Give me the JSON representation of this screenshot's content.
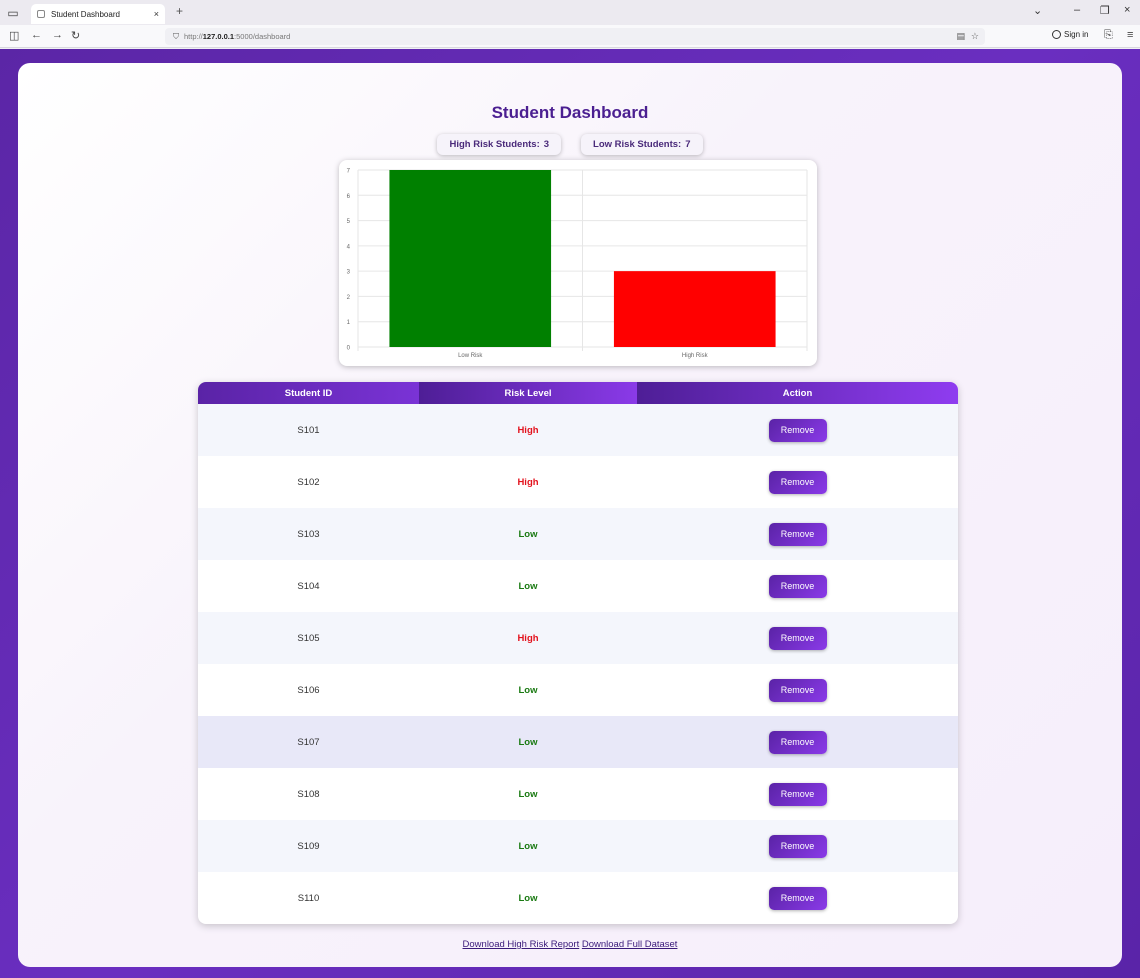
{
  "browser": {
    "tab_title": "Student Dashboard",
    "tab_close": "×",
    "new_tab": "+",
    "url_scheme": "http://",
    "url_host": "127.0.0.1",
    "url_path": ":5000/dashboard",
    "sign_in": "Sign in",
    "window_controls": {
      "minimize": "–",
      "restore": "❐",
      "close": "×"
    }
  },
  "page": {
    "title": "Student Dashboard",
    "stats": [
      {
        "label": "High Risk Students:",
        "value": "3"
      },
      {
        "label": "Low Risk Students:",
        "value": "7"
      }
    ]
  },
  "chart_data": {
    "type": "bar",
    "categories": [
      "Low Risk",
      "High Risk"
    ],
    "values": [
      7,
      3
    ],
    "colors": [
      "#008000",
      "#ff0000"
    ],
    "ylim": [
      0,
      7
    ],
    "yticks": [
      0,
      1,
      2,
      3,
      4,
      5,
      6,
      7
    ],
    "grid": true,
    "title": "",
    "xlabel": "",
    "ylabel": ""
  },
  "table": {
    "headers": [
      "Student ID",
      "Risk Level",
      "Action"
    ],
    "rows": [
      {
        "id": "S101",
        "risk": "High",
        "action": "Remove"
      },
      {
        "id": "S102",
        "risk": "High",
        "action": "Remove"
      },
      {
        "id": "S103",
        "risk": "Low",
        "action": "Remove"
      },
      {
        "id": "S104",
        "risk": "Low",
        "action": "Remove"
      },
      {
        "id": "S105",
        "risk": "High",
        "action": "Remove"
      },
      {
        "id": "S106",
        "risk": "Low",
        "action": "Remove"
      },
      {
        "id": "S107",
        "risk": "Low",
        "action": "Remove"
      },
      {
        "id": "S108",
        "risk": "Low",
        "action": "Remove"
      },
      {
        "id": "S109",
        "risk": "Low",
        "action": "Remove"
      },
      {
        "id": "S110",
        "risk": "Low",
        "action": "Remove"
      }
    ]
  },
  "downloads": {
    "high_risk": "Download High Risk Report",
    "full": "Download Full Dataset"
  },
  "colors": {
    "accent": "#5a23a6",
    "title": "#4b1f91",
    "high": "#e3121d",
    "low": "#1a7a12"
  }
}
